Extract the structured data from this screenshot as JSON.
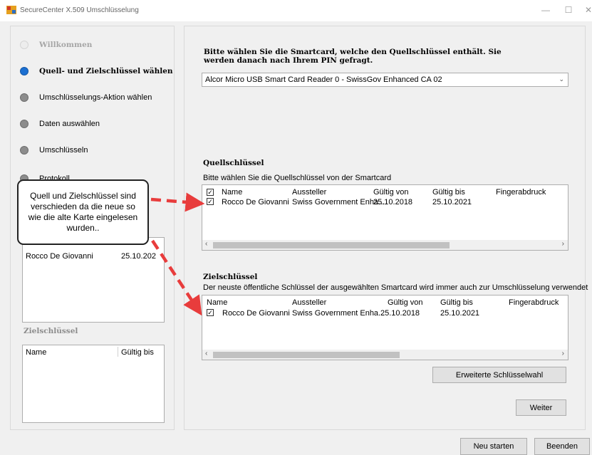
{
  "window": {
    "title": "SecureCenter X.509 Umschlüsselung",
    "minimize": "—",
    "maximize": "☐",
    "close": "✕"
  },
  "steps": [
    {
      "label": "Willkommen",
      "state": "disabled"
    },
    {
      "label": "Quell- und Zielschlüssel wählen",
      "state": "active"
    },
    {
      "label": "Umschlüsselungs-Aktion wählen",
      "state": "pending"
    },
    {
      "label": "Daten auswählen",
      "state": "pending"
    },
    {
      "label": "Umschlüsseln",
      "state": "pending"
    },
    {
      "label": "Protokoll",
      "state": "pending"
    }
  ],
  "left": {
    "source_row": {
      "name": "Rocco De Giovanni",
      "date": "25.10.202"
    },
    "target_title": "Zielschlüssel",
    "target_headers": {
      "name": "Name",
      "valid_until": "Gültig bis"
    }
  },
  "callout": {
    "text": "Quell und Zielschlüssel sind verschieden da die neue so wie die alte Karte eingelesen wurden.."
  },
  "right": {
    "instruction": "Bitte wählen Sie die Smartcard, welche den Quellschlüssel enthält. Sie werden danach nach Ihrem PIN gefragt.",
    "reader_selected": "Alcor Micro USB Smart Card Reader 0 - SwissGov Enhanced CA 02",
    "source": {
      "title": "Quellschlüssel",
      "subtitle": "Bitte wählen Sie die Quellschlüssel von der Smartcard",
      "headers": [
        "Name",
        "Aussteller",
        "Gültig von",
        "Gültig bis",
        "Fingerabdruck"
      ],
      "row": [
        "Rocco De Giovanni",
        "Swiss Government Enha...",
        "25.10.2018",
        "25.10.2021",
        ""
      ]
    },
    "target": {
      "title": "Zielschlüssel",
      "subtitle": "Der neuste öffentliche Schlüssel der ausgewählten Smartcard wird immer auch zur Umschlüsselung verwendet",
      "headers": [
        "Name",
        "Aussteller",
        "Gültig von",
        "Gültig bis",
        "Fingerabdruck"
      ],
      "row": [
        "Rocco De Giovanni",
        "Swiss Government Enha...",
        "25.10.2018",
        "25.10.2021",
        ""
      ]
    },
    "extended_button": "Erweiterte Schlüsselwahl",
    "next_button": "Weiter"
  },
  "footer": {
    "restart": "Neu starten",
    "quit": "Beenden"
  },
  "colors": {
    "active_step": "#1b6fd1",
    "arrow": "#e83c3c"
  }
}
